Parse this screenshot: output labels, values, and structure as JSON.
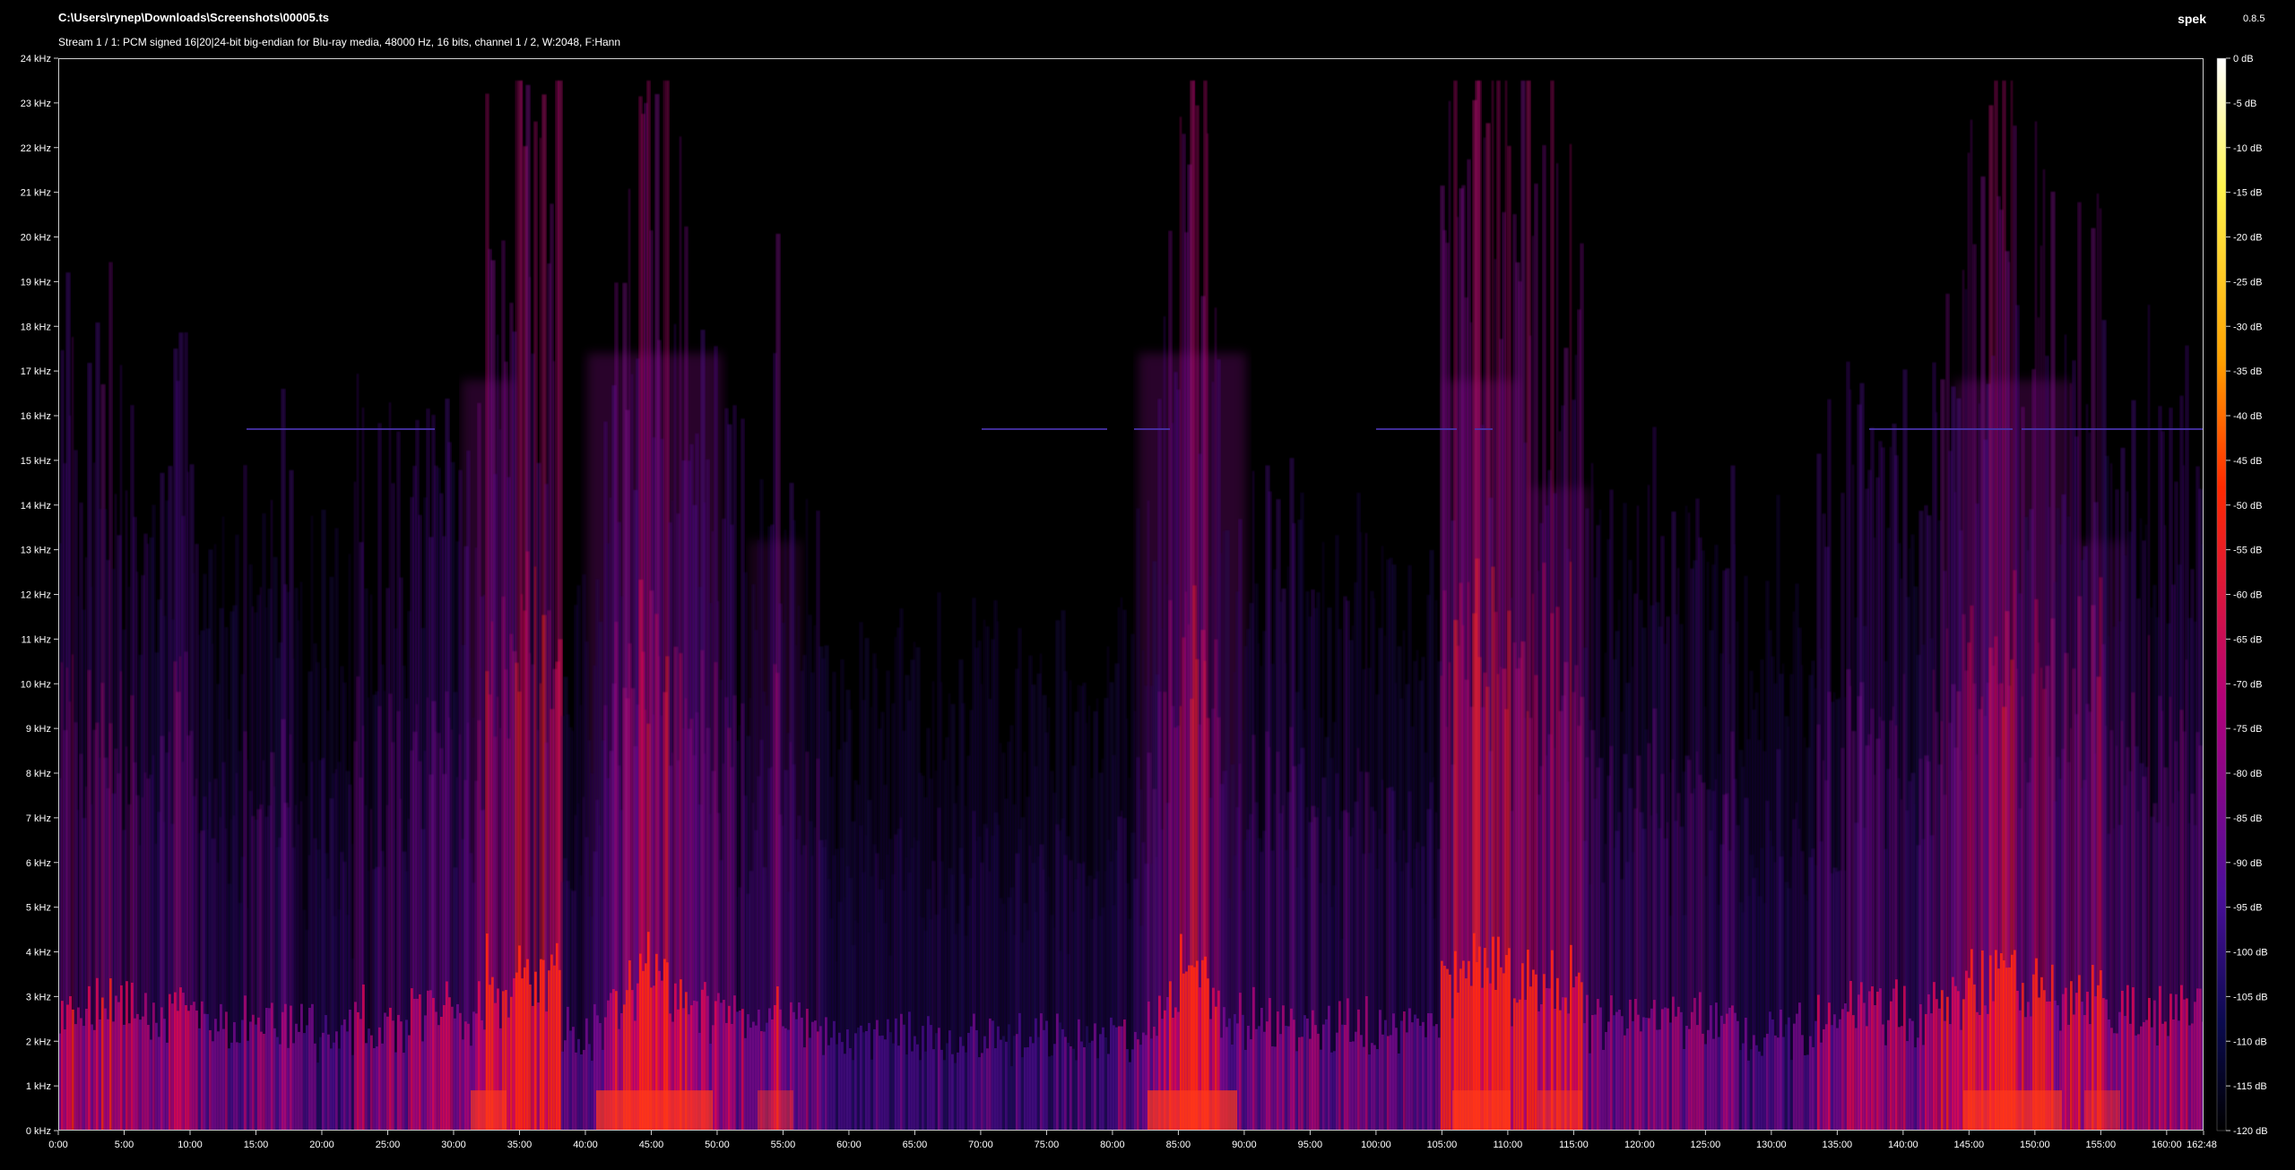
{
  "header": {
    "file_path": "C:\\Users\\rynep\\Downloads\\Screenshots\\00005.ts",
    "stream_info": "Stream 1 / 1: PCM signed 16|20|24-bit big-endian for Blu-ray media, 48000 Hz, 16 bits, channel 1 / 2, W:2048, F:Hann",
    "app_name": "spek",
    "app_version": "0.8.5"
  },
  "frequency_axis": {
    "labels": [
      "0 kHz",
      "1 kHz",
      "2 kHz",
      "3 kHz",
      "4 kHz",
      "5 kHz",
      "6 kHz",
      "7 kHz",
      "8 kHz",
      "9 kHz",
      "10 kHz",
      "11 kHz",
      "12 kHz",
      "13 kHz",
      "14 kHz",
      "15 kHz",
      "16 kHz",
      "17 kHz",
      "18 kHz",
      "19 kHz",
      "20 kHz",
      "21 kHz",
      "22 kHz",
      "23 kHz",
      "24 kHz"
    ]
  },
  "time_axis": {
    "labels": [
      "0:00",
      "5:00",
      "10:00",
      "15:00",
      "20:00",
      "25:00",
      "30:00",
      "35:00",
      "40:00",
      "45:00",
      "50:00",
      "55:00",
      "60:00",
      "65:00",
      "70:00",
      "75:00",
      "80:00",
      "85:00",
      "90:00",
      "95:00",
      "100:00",
      "105:00",
      "110:00",
      "115:00",
      "120:00",
      "125:00",
      "130:00",
      "135:00",
      "140:00",
      "145:00",
      "150:00",
      "155:00",
      "160:00"
    ],
    "end_label": "162:48"
  },
  "db_scale": {
    "labels": [
      "0 dB",
      "-5 dB",
      "-10 dB",
      "-15 dB",
      "-20 dB",
      "-25 dB",
      "-30 dB",
      "-35 dB",
      "-40 dB",
      "-45 dB",
      "-50 dB",
      "-55 dB",
      "-60 dB",
      "-65 dB",
      "-70 dB",
      "-75 dB",
      "-80 dB",
      "-85 dB",
      "-90 dB",
      "-95 dB",
      "-100 dB",
      "-105 dB",
      "-110 dB",
      "-115 dB",
      "-120 dB"
    ],
    "gradient_colors": [
      "#ffffff",
      "#fff44e",
      "#ffa200",
      "#ff2a00",
      "#b2007a",
      "#4a0e9a",
      "#0a0a4e",
      "#000000"
    ]
  },
  "chart_data": {
    "type": "heatmap",
    "xlabel": "",
    "ylabel": "",
    "x_range_seconds": [
      0,
      9768
    ],
    "y_range_khz": [
      0,
      24
    ],
    "z_range_db": [
      -120,
      0
    ],
    "frequency_ticks_khz": [
      0,
      1,
      2,
      3,
      4,
      5,
      6,
      7,
      8,
      9,
      10,
      11,
      12,
      13,
      14,
      15,
      16,
      17,
      18,
      19,
      20,
      21,
      22,
      23,
      24
    ],
    "time_ticks_min": [
      0,
      5,
      10,
      15,
      20,
      25,
      30,
      35,
      40,
      45,
      50,
      55,
      60,
      65,
      70,
      75,
      80,
      85,
      90,
      95,
      100,
      105,
      110,
      115,
      120,
      125,
      130,
      135,
      140,
      145,
      150,
      155,
      160
    ],
    "db_ticks": [
      0,
      -5,
      -10,
      -15,
      -20,
      -25,
      -30,
      -35,
      -40,
      -45,
      -50,
      -55,
      -60,
      -65,
      -70,
      -75,
      -80,
      -85,
      -90,
      -95,
      -100,
      -105,
      -110,
      -115,
      -120
    ]
  }
}
